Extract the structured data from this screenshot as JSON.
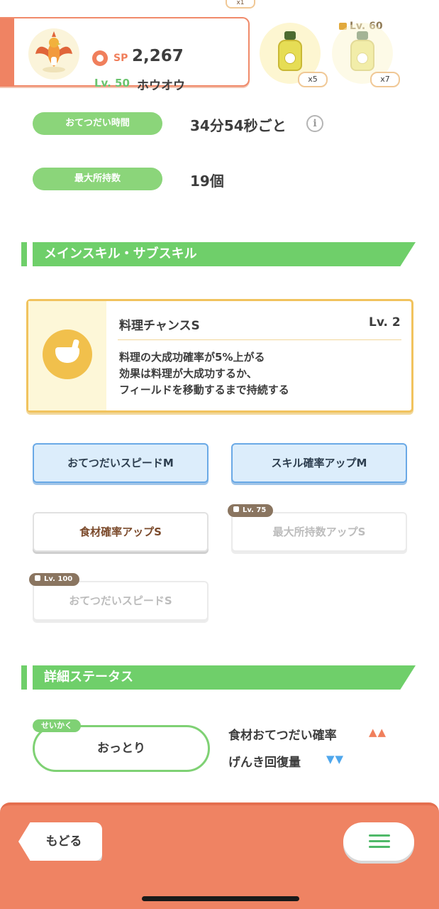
{
  "top": {
    "badge_count": "x1",
    "sp_label": "SP",
    "sp_value": "2,267",
    "level": "Lv. 50",
    "name": "ホウオウ",
    "items": [
      {
        "count": "x5",
        "icon": "oil-bottle-icon"
      },
      {
        "count": "x7",
        "icon": "oil-bottle-icon",
        "lock_level": "Lv. 60"
      }
    ]
  },
  "info": {
    "help_time_label": "おてつだい時間",
    "help_time_value": "34分54秒ごと",
    "max_carry_label": "最大所持数",
    "max_carry_value": "19個"
  },
  "section_skills": {
    "title": "メインスキル・サブスキル"
  },
  "main_skill": {
    "name": "料理チャンスS",
    "level": "Lv. 2",
    "description": "料理の大成功確率が5%上がる\n効果は料理が大成功するか、\nフィールドを移動するまで持続する"
  },
  "sub_skills": [
    {
      "label": "おてつだいスピードM",
      "state": "active-blue"
    },
    {
      "label": "スキル確率アップM",
      "state": "active-blue"
    },
    {
      "label": "食材確率アップS",
      "state": "active-white"
    },
    {
      "label": "最大所持数アップS",
      "state": "locked",
      "lock_level": "Lv. 75"
    },
    {
      "label": "おてつだいスピードS",
      "state": "locked",
      "lock_level": "Lv. 100"
    }
  ],
  "section_details": {
    "title": "詳細ステータス"
  },
  "nature": {
    "tag": "せいかく",
    "value": "おっとり",
    "up_label": "食材おてつだい確率",
    "up_arrows": "▲▲",
    "down_label": "げんき回復量",
    "down_arrows": "▼▼",
    "colors": {
      "up": "#f07f5c",
      "down": "#4fa7ec"
    }
  },
  "bottom": {
    "back_label": "もどる",
    "menu_icon": "hamburger-menu-icon"
  },
  "colors": {
    "accent_orange": "#ef8363",
    "accent_green": "#6fcf6a",
    "skill_gold": "#f1c35e"
  }
}
